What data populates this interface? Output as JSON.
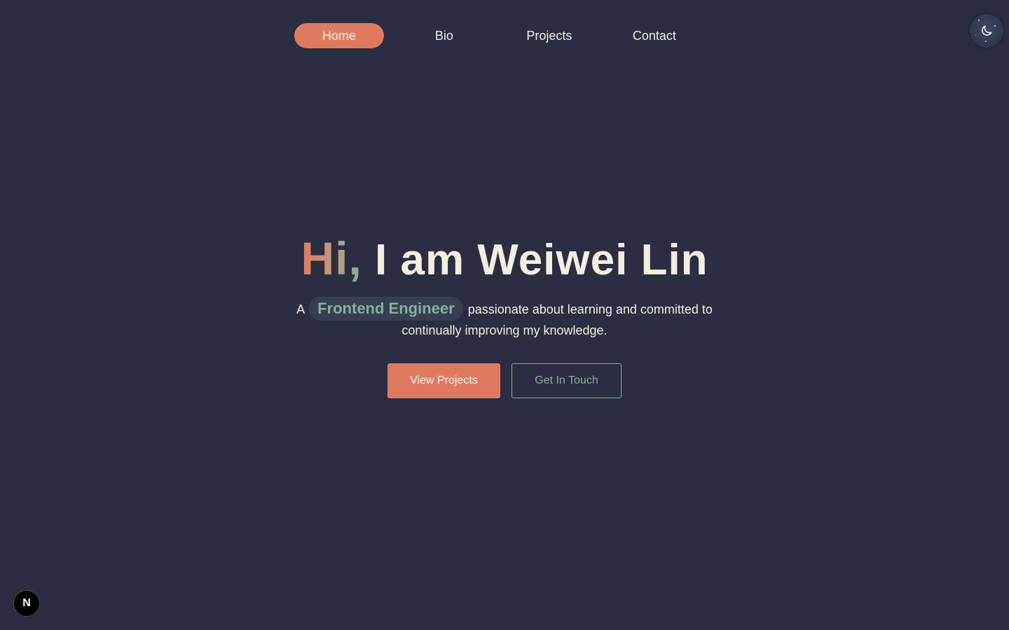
{
  "nav": {
    "items": [
      {
        "label": "Home",
        "active": true
      },
      {
        "label": "Bio",
        "active": false
      },
      {
        "label": "Projects",
        "active": false
      },
      {
        "label": "Contact",
        "active": false
      }
    ]
  },
  "theme_toggle": {
    "icon": "moon-icon"
  },
  "hero": {
    "greeting": "Hi,",
    "name_line": "I am Weiwei Lin",
    "subtitle_prefix": "A",
    "role": "Frontend Engineer",
    "subtitle_rest": "passionate about learning and committed to continually improving my knowledge."
  },
  "buttons": {
    "primary_label": "View Projects",
    "secondary_label": "Get In Touch"
  },
  "dev_badge": {
    "letter": "N",
    "icon": "nextjs-icon"
  },
  "colors": {
    "background": "#2b2d42",
    "accent": "#e07a5f",
    "secondary_accent": "#81b29a",
    "text": "#f3eedf"
  }
}
